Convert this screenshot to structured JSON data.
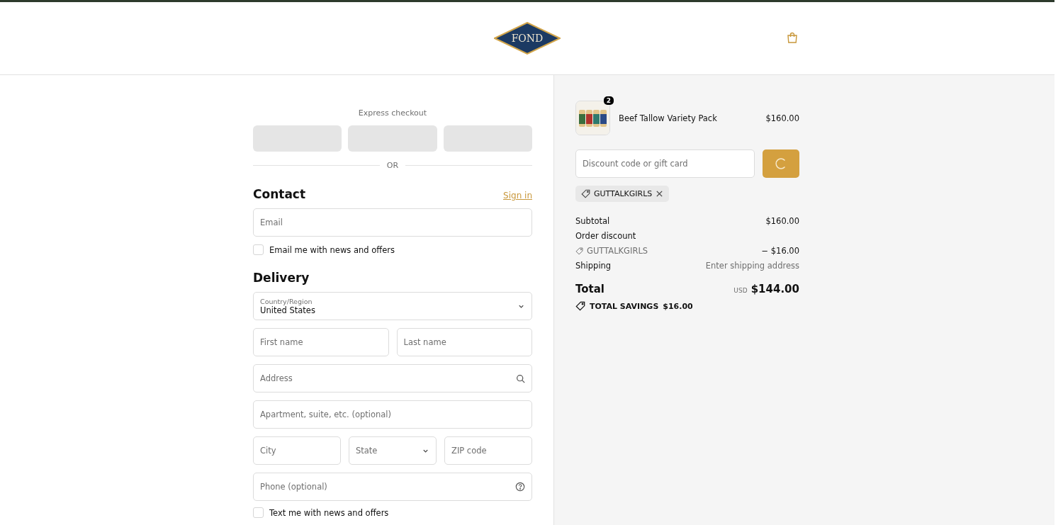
{
  "header": {
    "logo": {
      "name": "FOND"
    }
  },
  "express": {
    "title": "Express checkout",
    "divider": "OR"
  },
  "contact": {
    "title": "Contact",
    "link": "Sign in",
    "email": {
      "placeholder": "Email"
    },
    "newsletter": {
      "label": "Email me with news and offers",
      "checked": false
    }
  },
  "delivery": {
    "title": "Delivery",
    "rows": [
      {
        "fields": [
          {
            "kind": "select",
            "label": "Country/Region",
            "value": "United States"
          }
        ]
      },
      {
        "fields": [
          {
            "kind": "text",
            "placeholder": "First name"
          },
          {
            "kind": "text",
            "placeholder": "Last name"
          }
        ]
      },
      {
        "fields": [
          {
            "kind": "search",
            "placeholder": "Address"
          }
        ]
      },
      {
        "fields": [
          {
            "kind": "text",
            "placeholder": "Apartment, suite, etc. (optional)"
          }
        ]
      },
      {
        "fields": [
          {
            "kind": "text",
            "placeholder": "City"
          },
          {
            "kind": "dropdown",
            "placeholder": "State"
          },
          {
            "kind": "text",
            "placeholder": "ZIP code"
          }
        ]
      },
      {
        "fields": [
          {
            "kind": "help",
            "placeholder": "Phone (optional)"
          }
        ]
      }
    ],
    "sms": {
      "label": "Text me with news and offers",
      "checked": false
    }
  },
  "cart": {
    "item": {
      "name": "Beef Tallow Variety Pack",
      "price": "$160.00",
      "quantity": "2",
      "kind": "picture"
    },
    "discount": {
      "placeholder": "Discount code or gift card",
      "loading": true
    },
    "applied_code": "GUTTALKGIRLS",
    "lines": [
      {
        "kind": "plain",
        "label": "Subtotal",
        "value": "$160.00"
      },
      {
        "kind": "heading",
        "label": "Order discount"
      },
      {
        "kind": "code",
        "label": "GUTTALKGIRLS",
        "value": "− $16.00"
      },
      {
        "kind": "muted",
        "label": "Shipping",
        "value": "Enter shipping address"
      }
    ],
    "total": {
      "label": "Total",
      "currency": "USD",
      "value": "$144.00"
    },
    "savings": {
      "label": "TOTAL SAVINGS",
      "value": "$16.00"
    }
  }
}
